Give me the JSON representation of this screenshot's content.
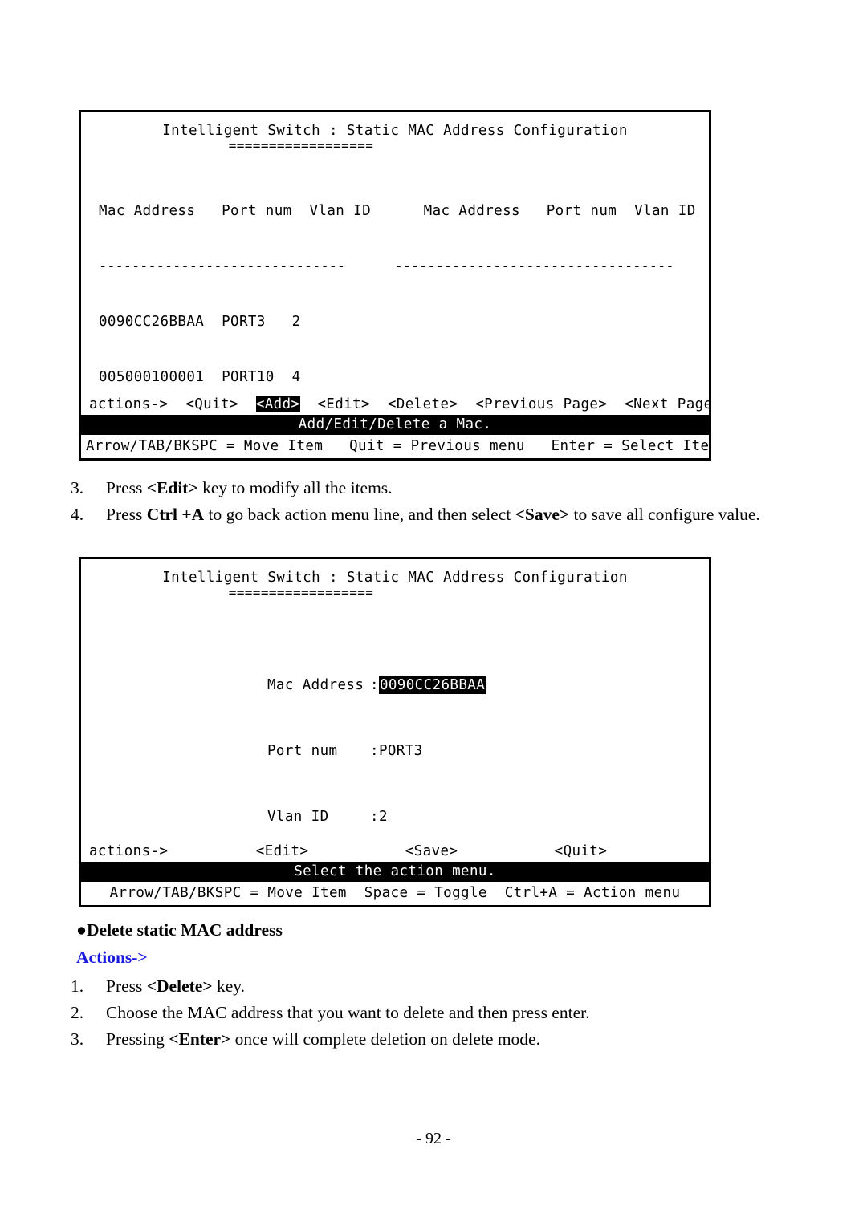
{
  "page": {
    "page_number": "- 92 -"
  },
  "terminal_1": {
    "title": "Intelligent Switch : Static MAC Address Configuration",
    "title_underline": "==================",
    "table": {
      "headers_left": "Mac Address   Port num  Vlan ID",
      "headers_right": "Mac Address   Port num  Vlan ID",
      "separator_left": "------------------------------",
      "separator_right": "----------------------------------",
      "columns": [
        "Mac Address",
        "Port num",
        "Vlan ID"
      ],
      "rows": [
        {
          "mac": "0090CC26BBAA",
          "port": "PORT3",
          "vlan": "2"
        },
        {
          "mac": "005000100001",
          "port": "PORT10",
          "vlan": "4"
        }
      ],
      "rows_right": []
    },
    "actions_label": "actions->",
    "actions": [
      {
        "label": "<Quit>",
        "selected": false
      },
      {
        "label": "<Add>",
        "selected": true
      },
      {
        "label": "<Edit>",
        "selected": false
      },
      {
        "label": "<Delete>",
        "selected": false
      },
      {
        "label": "<Previous Page>",
        "selected": false
      },
      {
        "label": "<Next Page>",
        "selected": false
      }
    ],
    "status": "Add/Edit/Delete a Mac.",
    "help": "Arrow/TAB/BKSPC = Move Item   Quit = Previous menu   Enter = Select Item"
  },
  "terminal_2": {
    "title": "Intelligent Switch : Static MAC Address Configuration",
    "title_underline": "==================",
    "fields": [
      {
        "label": "Mac Address",
        "value": "0090CC26BBAA",
        "highlighted": true
      },
      {
        "label": "Port num",
        "value": "PORT3",
        "highlighted": false
      },
      {
        "label": "Vlan ID",
        "value": "2",
        "highlighted": false
      }
    ],
    "actions_label": "actions->",
    "actions": [
      {
        "label": "<Edit>",
        "selected": false
      },
      {
        "label": "<Save>",
        "selected": false
      },
      {
        "label": "<Quit>",
        "selected": false
      }
    ],
    "status": "Select the action menu.",
    "help": "Arrow/TAB/BKSPC = Move Item  Space = Toggle  Ctrl+A = Action menu"
  },
  "body": {
    "steps_upper": [
      {
        "marker": "3.",
        "parts": [
          {
            "text": "Press ",
            "bold": false
          },
          {
            "text": "<Edit>",
            "bold": true
          },
          {
            "text": " key to modify all the items.",
            "bold": false
          }
        ]
      },
      {
        "marker": "4.",
        "parts": [
          {
            "text": "Press ",
            "bold": false
          },
          {
            "text": "Ctrl +A",
            "bold": true
          },
          {
            "text": " to go back action menu line, and then select ",
            "bold": false
          },
          {
            "text": "<Save>",
            "bold": true
          },
          {
            "text": " to save all configure value.",
            "bold": false
          }
        ]
      }
    ],
    "section_heading": "Delete static MAC address",
    "section_bullet": "●",
    "actions_link": "Actions->",
    "steps_lower": [
      {
        "marker": "1.",
        "parts": [
          {
            "text": "Press ",
            "bold": false
          },
          {
            "text": "<Delete>",
            "bold": true
          },
          {
            "text": " key.",
            "bold": false
          }
        ]
      },
      {
        "marker": "2.",
        "parts": [
          {
            "text": "Choose the MAC address that you want to delete and then press enter.",
            "bold": false
          }
        ]
      },
      {
        "marker": "3.",
        "parts": [
          {
            "text": "Pressing ",
            "bold": false
          },
          {
            "text": "<Enter>",
            "bold": true
          },
          {
            "text": " once will complete deletion on delete mode.",
            "bold": false
          }
        ]
      }
    ]
  },
  "colors": {
    "link_blue": "#1a1ae0",
    "text_black": "#000000",
    "background": "#ffffff"
  }
}
